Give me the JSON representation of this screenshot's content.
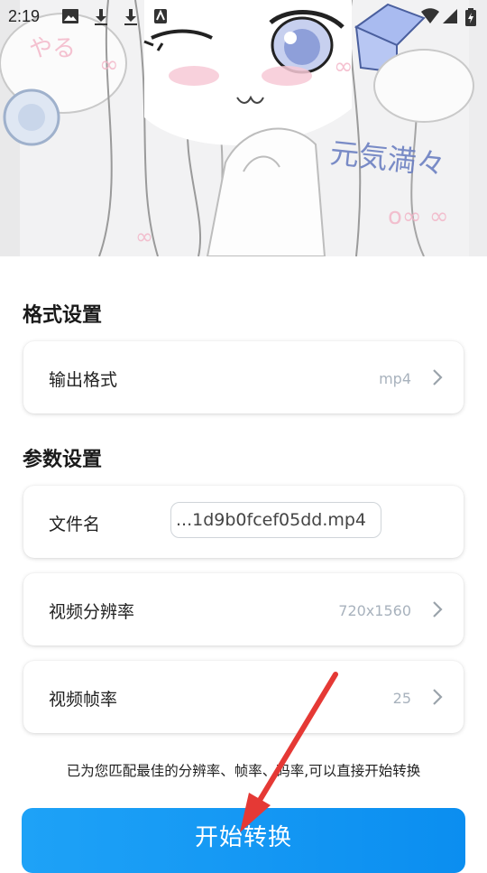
{
  "status_bar": {
    "time": "2:19"
  },
  "banner": {
    "art_text": "元気満々",
    "deco_left": "やる"
  },
  "format_section": {
    "title": "格式设置",
    "output_format": {
      "label": "输出格式",
      "value": "mp4"
    }
  },
  "param_section": {
    "title": "参数设置",
    "file_name": {
      "label": "文件名",
      "value": "...1d9b0fcef05dd.mp4"
    },
    "resolution": {
      "label": "视频分辨率",
      "value": "720x1560"
    },
    "frame_rate": {
      "label": "视频帧率",
      "value": "25"
    }
  },
  "hint_text": "已为您匹配最佳的分辨率、帧率、码率,可以直接开始转换",
  "start_button": {
    "label": "开始转换"
  },
  "colors": {
    "accent": "#1295f3",
    "annotation_arrow": "#e53935",
    "value_text": "#a8b2bd"
  },
  "icons": [
    "image-icon",
    "download-icon",
    "download-icon",
    "android-icon",
    "wifi-icon",
    "signal-icon",
    "battery-icon",
    "chevron-right-icon"
  ]
}
